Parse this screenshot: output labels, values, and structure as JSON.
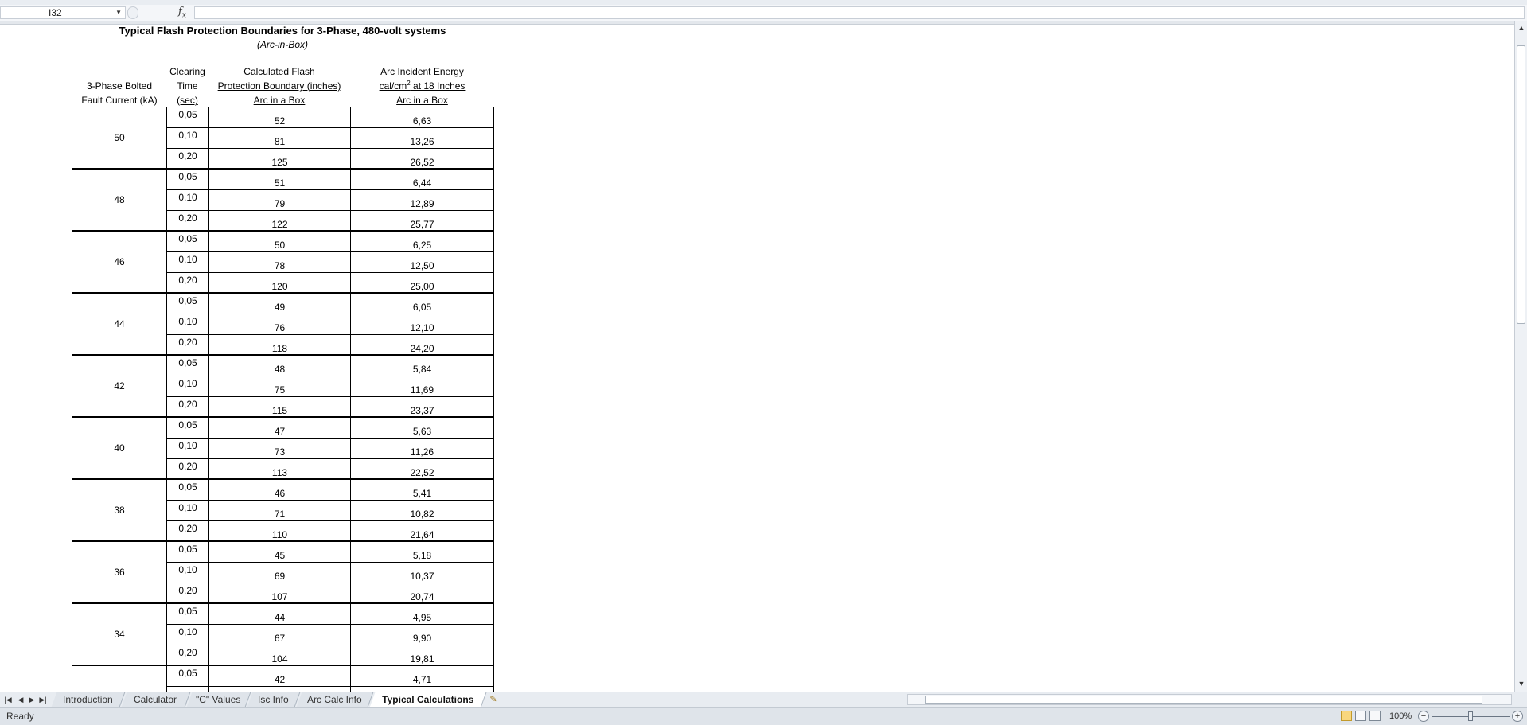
{
  "formula_bar": {
    "cell_ref": "I32",
    "fx_label": "fx",
    "formula": ""
  },
  "sheet": {
    "title": "Typical Flash Protection Boundaries for 3-Phase, 480-volt systems",
    "subtitle": "(Arc-in-Box)",
    "headers": {
      "fault_current": [
        "3-Phase Bolted",
        "Fault Current (kA)"
      ],
      "clearing_time": [
        "Clearing",
        "Time",
        "(sec)"
      ],
      "flash_boundary": [
        "Calculated Flash",
        "Protection Boundary (inches)",
        "Arc in a Box"
      ],
      "incident_energy": [
        "Arc Incident Energy",
        "cal/cm",
        "2",
        " at 18 Inches",
        "Arc in a Box"
      ]
    },
    "groups": [
      {
        "fault_current": "50",
        "rows": [
          {
            "time": "0,05",
            "boundary": "52",
            "energy": "6,63"
          },
          {
            "time": "0,10",
            "boundary": "81",
            "energy": "13,26"
          },
          {
            "time": "0,20",
            "boundary": "125",
            "energy": "26,52"
          }
        ]
      },
      {
        "fault_current": "48",
        "rows": [
          {
            "time": "0,05",
            "boundary": "51",
            "energy": "6,44"
          },
          {
            "time": "0,10",
            "boundary": "79",
            "energy": "12,89"
          },
          {
            "time": "0,20",
            "boundary": "122",
            "energy": "25,77"
          }
        ]
      },
      {
        "fault_current": "46",
        "rows": [
          {
            "time": "0,05",
            "boundary": "50",
            "energy": "6,25"
          },
          {
            "time": "0,10",
            "boundary": "78",
            "energy": "12,50"
          },
          {
            "time": "0,20",
            "boundary": "120",
            "energy": "25,00"
          }
        ]
      },
      {
        "fault_current": "44",
        "rows": [
          {
            "time": "0,05",
            "boundary": "49",
            "energy": "6,05"
          },
          {
            "time": "0,10",
            "boundary": "76",
            "energy": "12,10"
          },
          {
            "time": "0,20",
            "boundary": "118",
            "energy": "24,20"
          }
        ]
      },
      {
        "fault_current": "42",
        "rows": [
          {
            "time": "0,05",
            "boundary": "48",
            "energy": "5,84"
          },
          {
            "time": "0,10",
            "boundary": "75",
            "energy": "11,69"
          },
          {
            "time": "0,20",
            "boundary": "115",
            "energy": "23,37"
          }
        ]
      },
      {
        "fault_current": "40",
        "rows": [
          {
            "time": "0,05",
            "boundary": "47",
            "energy": "5,63"
          },
          {
            "time": "0,10",
            "boundary": "73",
            "energy": "11,26"
          },
          {
            "time": "0,20",
            "boundary": "113",
            "energy": "22,52"
          }
        ]
      },
      {
        "fault_current": "38",
        "rows": [
          {
            "time": "0,05",
            "boundary": "46",
            "energy": "5,41"
          },
          {
            "time": "0,10",
            "boundary": "71",
            "energy": "10,82"
          },
          {
            "time": "0,20",
            "boundary": "110",
            "energy": "21,64"
          }
        ]
      },
      {
        "fault_current": "36",
        "rows": [
          {
            "time": "0,05",
            "boundary": "45",
            "energy": "5,18"
          },
          {
            "time": "0,10",
            "boundary": "69",
            "energy": "10,37"
          },
          {
            "time": "0,20",
            "boundary": "107",
            "energy": "20,74"
          }
        ]
      },
      {
        "fault_current": "34",
        "rows": [
          {
            "time": "0,05",
            "boundary": "44",
            "energy": "4,95"
          },
          {
            "time": "0,10",
            "boundary": "67",
            "energy": "9,90"
          },
          {
            "time": "0,20",
            "boundary": "104",
            "energy": "19,81"
          }
        ]
      },
      {
        "fault_current": "",
        "rows": [
          {
            "time": "0,05",
            "boundary": "42",
            "energy": "4,71"
          },
          {
            "time": "",
            "boundary": "",
            "energy": ""
          },
          {
            "time": "",
            "boundary": "",
            "energy": ""
          }
        ]
      }
    ]
  },
  "tabs": [
    {
      "label": "Introduction",
      "active": false
    },
    {
      "label": "Calculator",
      "active": false
    },
    {
      "label": "\"C\" Values",
      "active": false
    },
    {
      "label": "Isc Info",
      "active": false
    },
    {
      "label": "Arc Calc Info",
      "active": false
    },
    {
      "label": "Typical Calculations",
      "active": true
    }
  ],
  "status": {
    "ready": "Ready",
    "zoom": "100%"
  },
  "icons": {
    "nav_first": "first-sheet-icon",
    "nav_prev": "prev-sheet-icon",
    "nav_next": "next-sheet-icon",
    "nav_last": "last-sheet-icon",
    "new_sheet": "insert-sheet-icon",
    "fx": "function-icon"
  }
}
